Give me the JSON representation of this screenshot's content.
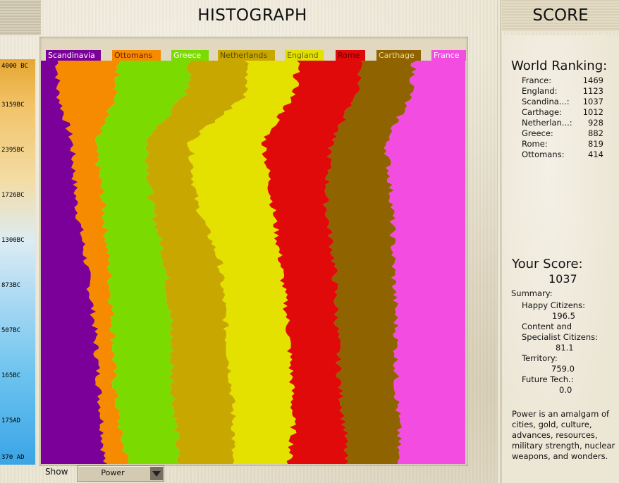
{
  "histograph": {
    "title": "HISTOGRAPH",
    "time_labels": [
      "4000 BC",
      "3159BC",
      "2395BC",
      "1726BC",
      "1300BC",
      "873BC",
      "507BC",
      "165BC",
      "175AD",
      "370 AD"
    ],
    "civs": [
      {
        "name": "Scandinavia",
        "color": "#7a0099",
        "text_color": "#ffffff"
      },
      {
        "name": "Ottomans",
        "color": "#f68a00",
        "text_color": "#6a2000"
      },
      {
        "name": "Greece",
        "color": "#7bdb00",
        "text_color": "#ffffff"
      },
      {
        "name": "Netherlands",
        "color": "#c8a800",
        "text_color": "#5a4600"
      },
      {
        "name": "England",
        "color": "#e4e000",
        "text_color": "#6a6a00"
      },
      {
        "name": "Rome",
        "color": "#e10a0a",
        "text_color": "#6a0000"
      },
      {
        "name": "Carthage",
        "color": "#8f6400",
        "text_color": "#f4d78a"
      },
      {
        "name": "France",
        "color": "#f24ce0",
        "text_color": "#ffffff"
      }
    ],
    "show_label": "Show",
    "show_value": "Power"
  },
  "score_panel": {
    "title": "SCORE",
    "world_ranking_heading": "World Ranking:",
    "rankings": [
      {
        "name": "France:",
        "score": "1469"
      },
      {
        "name": "England:",
        "score": "1123"
      },
      {
        "name": "Scandina...:",
        "score": "1037"
      },
      {
        "name": "Carthage:",
        "score": "1012"
      },
      {
        "name": "Netherlan...:",
        "score": "928"
      },
      {
        "name": "Greece:",
        "score": "882"
      },
      {
        "name": "Rome:",
        "score": "819"
      },
      {
        "name": "Ottomans:",
        "score": "414"
      }
    ],
    "your_score_heading": "Your Score:",
    "your_score": "1037",
    "summary_label": "Summary:",
    "happy_label": "Happy Citizens:",
    "happy_value": "196.5",
    "content_label_1": "Content and",
    "content_label_2": "Specialist Citizens:",
    "content_value": "81.1",
    "territory_label": "Territory:",
    "territory_value": "759.0",
    "future_label": "Future Tech.:",
    "future_value": "0.0",
    "power_lines": [
      "Power is an amalgam of",
      "cities, gold, culture,",
      "advances, resources,",
      "military strength, nuclear",
      "weapons, and wonders."
    ]
  }
}
